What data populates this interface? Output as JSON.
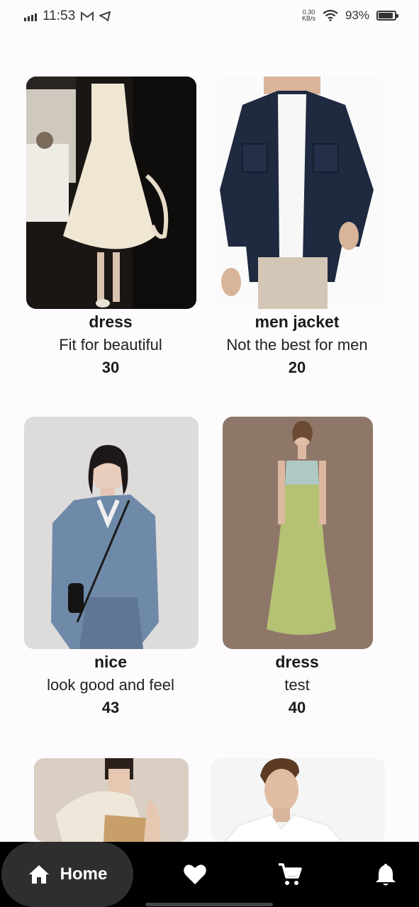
{
  "status_bar": {
    "time": "11:53",
    "net_speed_value": "0.30",
    "net_speed_unit": "KB/s",
    "battery": "93%",
    "battery_level": 0.93
  },
  "products": [
    {
      "title": "dress",
      "description": "Fit for beautiful",
      "price": "30"
    },
    {
      "title": "men jacket",
      "description": "Not the best for men",
      "price": "20"
    },
    {
      "title": "nice",
      "description": "look good and feel",
      "price": "43"
    },
    {
      "title": "dress",
      "description": "test",
      "price": "40"
    },
    {
      "title": "",
      "description": "",
      "price": ""
    },
    {
      "title": "",
      "description": "",
      "price": ""
    }
  ],
  "nav": {
    "home_label": "Home",
    "icons": [
      "home-icon",
      "heart-icon",
      "cart-icon",
      "bell-icon"
    ],
    "active": "home"
  }
}
